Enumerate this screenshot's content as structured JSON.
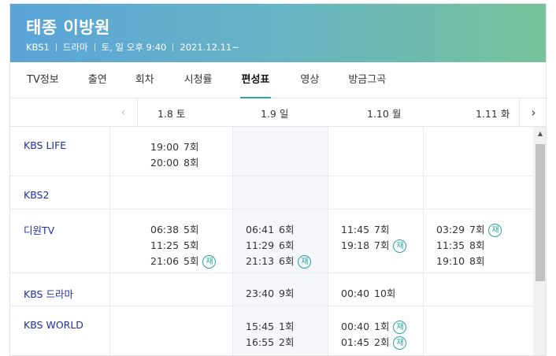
{
  "program": {
    "title": "태종 이방원",
    "meta": [
      "KBS1",
      "드라마",
      "토, 일 오후 9:40",
      "2021.12.11~"
    ]
  },
  "tabs": [
    {
      "label": "TV정보",
      "active": false
    },
    {
      "label": "출연",
      "active": false
    },
    {
      "label": "회차",
      "active": false
    },
    {
      "label": "시청률",
      "active": false
    },
    {
      "label": "편성표",
      "active": true
    },
    {
      "label": "영상",
      "active": false
    },
    {
      "label": "방금그곡",
      "active": false
    }
  ],
  "schedule": {
    "prev_icon": "chevron-left-icon",
    "next_icon": "chevron-right-icon",
    "days": [
      {
        "date": "1.8",
        "weekday": "토"
      },
      {
        "date": "1.9",
        "weekday": "일"
      },
      {
        "date": "1.10",
        "weekday": "월"
      },
      {
        "date": "1.11",
        "weekday": "화"
      }
    ],
    "rerun_label": "재",
    "rows": [
      {
        "channel": "KBS LIFE",
        "cells": [
          [
            {
              "time": "19:00",
              "ep": "7회",
              "rerun": false
            },
            {
              "time": "20:00",
              "ep": "8회",
              "rerun": false
            }
          ],
          [],
          [],
          []
        ]
      },
      {
        "channel": "KBS2",
        "cells": [
          [],
          [],
          [],
          []
        ]
      },
      {
        "channel": "디원TV",
        "cells": [
          [
            {
              "time": "06:38",
              "ep": "5회",
              "rerun": false
            },
            {
              "time": "11:25",
              "ep": "5회",
              "rerun": false
            },
            {
              "time": "21:06",
              "ep": "5회",
              "rerun": true
            }
          ],
          [
            {
              "time": "06:41",
              "ep": "6회",
              "rerun": false
            },
            {
              "time": "11:29",
              "ep": "6회",
              "rerun": false
            },
            {
              "time": "21:13",
              "ep": "6회",
              "rerun": true
            }
          ],
          [
            {
              "time": "11:45",
              "ep": "7회",
              "rerun": false
            },
            {
              "time": "19:18",
              "ep": "7회",
              "rerun": true
            }
          ],
          [
            {
              "time": "03:29",
              "ep": "7회",
              "rerun": true
            },
            {
              "time": "11:35",
              "ep": "8회",
              "rerun": false
            },
            {
              "time": "19:10",
              "ep": "8회",
              "rerun": false
            }
          ]
        ]
      },
      {
        "channel": "KBS 드라마",
        "cells": [
          [],
          [
            {
              "time": "23:40",
              "ep": "9회",
              "rerun": false
            }
          ],
          [
            {
              "time": "00:40",
              "ep": "10회",
              "rerun": false
            }
          ],
          []
        ]
      },
      {
        "channel": "KBS WORLD",
        "cells": [
          [],
          [
            {
              "time": "15:45",
              "ep": "1회",
              "rerun": false
            },
            {
              "time": "16:55",
              "ep": "2회",
              "rerun": false
            }
          ],
          [
            {
              "time": "00:40",
              "ep": "1회",
              "rerun": true
            },
            {
              "time": "01:45",
              "ep": "2회",
              "rerun": true
            }
          ],
          []
        ]
      }
    ]
  },
  "colors": {
    "header_gradient": [
      "#5aa4d9",
      "#77c39a"
    ],
    "channel_link": "#1f2fa0",
    "accent": "#2aa7a0",
    "highlight_column": "#f5f7fb"
  }
}
